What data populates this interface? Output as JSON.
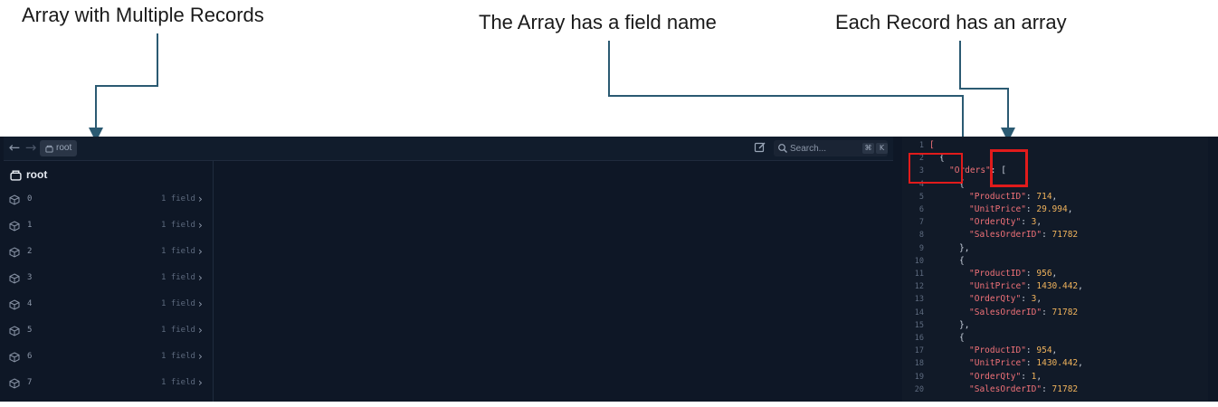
{
  "annotations": {
    "left": "Array with Multiple Records",
    "middle": "The Array has a field name",
    "right": "Each Record has an array"
  },
  "toolbar": {
    "back_icon": "arrow-left-icon",
    "forward_icon": "arrow-right-icon",
    "breadcrumb": "root",
    "search_placeholder": "Search...",
    "shortcut_mod": "⌘",
    "shortcut_key": "K"
  },
  "sidebar": {
    "title": "root",
    "items": [
      {
        "index": "0",
        "meta": "1 field"
      },
      {
        "index": "1",
        "meta": "1 field"
      },
      {
        "index": "2",
        "meta": "1 field"
      },
      {
        "index": "3",
        "meta": "1 field"
      },
      {
        "index": "4",
        "meta": "1 field"
      },
      {
        "index": "5",
        "meta": "1 field"
      },
      {
        "index": "6",
        "meta": "1 field"
      },
      {
        "index": "7",
        "meta": "1 field"
      }
    ]
  },
  "editor": {
    "lines": [
      {
        "n": "1",
        "parts": [
          {
            "t": "[",
            "c": "bracket-hl"
          }
        ],
        "indent": 0
      },
      {
        "n": "2",
        "parts": [
          {
            "t": "{",
            "c": "p"
          }
        ],
        "indent": 1
      },
      {
        "n": "3",
        "parts": [
          {
            "t": "\"Orders\"",
            "c": "k"
          },
          {
            "t": ": [",
            "c": "p"
          }
        ],
        "indent": 2
      },
      {
        "n": "4",
        "parts": [
          {
            "t": "{",
            "c": "p"
          }
        ],
        "indent": 3
      },
      {
        "n": "5",
        "parts": [
          {
            "t": "\"ProductID\"",
            "c": "k"
          },
          {
            "t": ": ",
            "c": "p"
          },
          {
            "t": "714",
            "c": "n"
          },
          {
            "t": ",",
            "c": "p"
          }
        ],
        "indent": 4
      },
      {
        "n": "6",
        "parts": [
          {
            "t": "\"UnitPrice\"",
            "c": "k"
          },
          {
            "t": ": ",
            "c": "p"
          },
          {
            "t": "29.994",
            "c": "n"
          },
          {
            "t": ",",
            "c": "p"
          }
        ],
        "indent": 4
      },
      {
        "n": "7",
        "parts": [
          {
            "t": "\"OrderQty\"",
            "c": "k"
          },
          {
            "t": ": ",
            "c": "p"
          },
          {
            "t": "3",
            "c": "n"
          },
          {
            "t": ",",
            "c": "p"
          }
        ],
        "indent": 4
      },
      {
        "n": "8",
        "parts": [
          {
            "t": "\"SalesOrderID\"",
            "c": "k"
          },
          {
            "t": ": ",
            "c": "p"
          },
          {
            "t": "71782",
            "c": "n"
          }
        ],
        "indent": 4
      },
      {
        "n": "9",
        "parts": [
          {
            "t": "},",
            "c": "p"
          }
        ],
        "indent": 3
      },
      {
        "n": "10",
        "parts": [
          {
            "t": "{",
            "c": "p"
          }
        ],
        "indent": 3
      },
      {
        "n": "11",
        "parts": [
          {
            "t": "\"ProductID\"",
            "c": "k"
          },
          {
            "t": ": ",
            "c": "p"
          },
          {
            "t": "956",
            "c": "n"
          },
          {
            "t": ",",
            "c": "p"
          }
        ],
        "indent": 4
      },
      {
        "n": "12",
        "parts": [
          {
            "t": "\"UnitPrice\"",
            "c": "k"
          },
          {
            "t": ": ",
            "c": "p"
          },
          {
            "t": "1430.442",
            "c": "n"
          },
          {
            "t": ",",
            "c": "p"
          }
        ],
        "indent": 4
      },
      {
        "n": "13",
        "parts": [
          {
            "t": "\"OrderQty\"",
            "c": "k"
          },
          {
            "t": ": ",
            "c": "p"
          },
          {
            "t": "3",
            "c": "n"
          },
          {
            "t": ",",
            "c": "p"
          }
        ],
        "indent": 4
      },
      {
        "n": "14",
        "parts": [
          {
            "t": "\"SalesOrderID\"",
            "c": "k"
          },
          {
            "t": ": ",
            "c": "p"
          },
          {
            "t": "71782",
            "c": "n"
          }
        ],
        "indent": 4
      },
      {
        "n": "15",
        "parts": [
          {
            "t": "},",
            "c": "p"
          }
        ],
        "indent": 3
      },
      {
        "n": "16",
        "parts": [
          {
            "t": "{",
            "c": "p"
          }
        ],
        "indent": 3
      },
      {
        "n": "17",
        "parts": [
          {
            "t": "\"ProductID\"",
            "c": "k"
          },
          {
            "t": ": ",
            "c": "p"
          },
          {
            "t": "954",
            "c": "n"
          },
          {
            "t": ",",
            "c": "p"
          }
        ],
        "indent": 4
      },
      {
        "n": "18",
        "parts": [
          {
            "t": "\"UnitPrice\"",
            "c": "k"
          },
          {
            "t": ": ",
            "c": "p"
          },
          {
            "t": "1430.442",
            "c": "n"
          },
          {
            "t": ",",
            "c": "p"
          }
        ],
        "indent": 4
      },
      {
        "n": "19",
        "parts": [
          {
            "t": "\"OrderQty\"",
            "c": "k"
          },
          {
            "t": ": ",
            "c": "p"
          },
          {
            "t": "1",
            "c": "n"
          },
          {
            "t": ",",
            "c": "p"
          }
        ],
        "indent": 4
      },
      {
        "n": "20",
        "parts": [
          {
            "t": "\"SalesOrderID\"",
            "c": "k"
          },
          {
            "t": ": ",
            "c": "p"
          },
          {
            "t": "71782",
            "c": "n"
          }
        ],
        "indent": 4
      }
    ]
  },
  "colors": {
    "annotation_arrow": "#2b5a72",
    "highlight_box": "#e11b1b",
    "app_background": "#0e1726",
    "json_key": "#f07178",
    "json_number": "#f0b35c"
  }
}
